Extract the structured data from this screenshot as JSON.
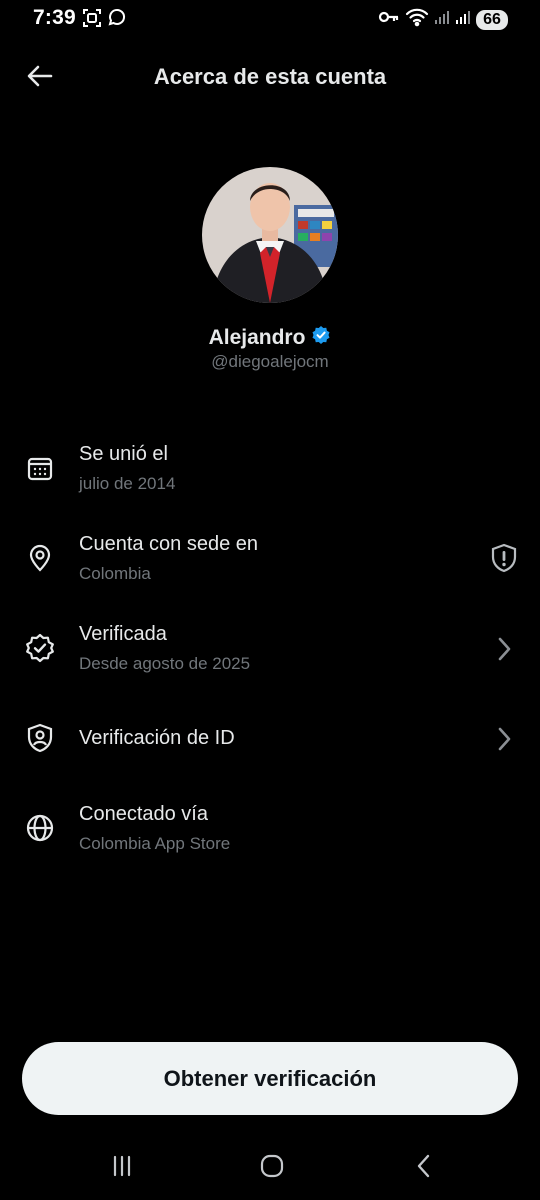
{
  "status_bar": {
    "time": "7:39",
    "battery": "66",
    "left_icons": [
      "screenshot-icon",
      "whatsapp-icon"
    ],
    "right_icons": [
      "key-icon",
      "wifi-icon",
      "signal-icon",
      "signal-icon"
    ]
  },
  "header": {
    "title": "Acerca de esta cuenta",
    "back_icon": "arrow-left-icon"
  },
  "profile": {
    "display_name": "Alejandro",
    "handle": "@diegoalejocm",
    "verified": true,
    "verified_color": "#1d9bf0"
  },
  "info_items": [
    {
      "title": "Se unió el",
      "subtitle": "julio de 2014",
      "icon": "calendar-icon",
      "trailing": ""
    },
    {
      "title": "Cuenta con sede en",
      "subtitle": "Colombia",
      "icon": "location-pin-icon",
      "trailing": "shield-alert-icon"
    },
    {
      "title": "Verificada",
      "subtitle": "Desde agosto de 2025",
      "icon": "verified-badge-icon",
      "trailing": "chevron-right-icon"
    },
    {
      "title": "Verificación de ID",
      "subtitle": "",
      "icon": "id-shield-icon",
      "trailing": "chevron-right-icon"
    },
    {
      "title": "Conectado vía",
      "subtitle": "Colombia App Store",
      "icon": "globe-icon",
      "trailing": ""
    }
  ],
  "cta": {
    "label": "Obtener verificación"
  },
  "nav_bar": {
    "icons": [
      "recents-icon",
      "home-icon",
      "back-icon"
    ]
  },
  "colors": {
    "background": "#000000",
    "primary_text": "#e7e9ea",
    "secondary_text": "#71767b",
    "button_bg": "#eff3f4",
    "button_text": "#0f1419"
  }
}
